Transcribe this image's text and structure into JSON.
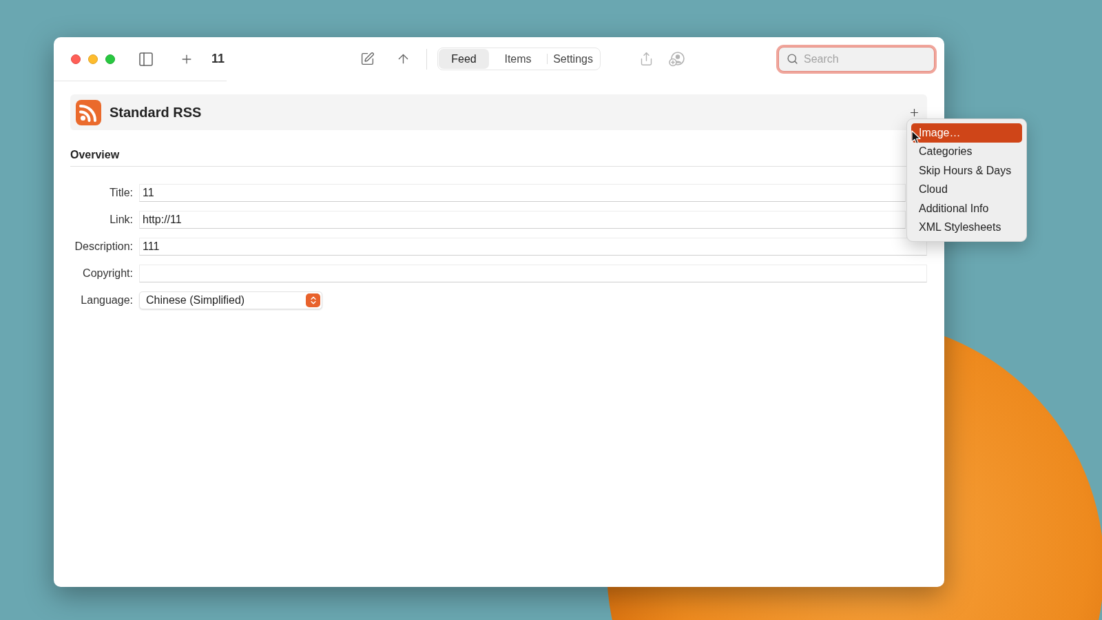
{
  "window": {
    "title": "11"
  },
  "toolbar": {
    "tabs": [
      {
        "label": "Feed",
        "selected": true
      },
      {
        "label": "Items",
        "selected": false
      },
      {
        "label": "Settings",
        "selected": false
      }
    ],
    "share_button": {
      "disabled": true
    },
    "collaborate_button": {
      "disabled": true
    },
    "search": {
      "placeholder": "Search",
      "focused": true
    }
  },
  "feed_header": {
    "title": "Standard RSS"
  },
  "overview": {
    "heading": "Overview",
    "fields": [
      {
        "label": "Title:",
        "kind": "text",
        "value": "11"
      },
      {
        "label": "Link:",
        "kind": "text",
        "value": "http://11"
      },
      {
        "label": "Description:",
        "kind": "text",
        "value": "111"
      },
      {
        "label": "Copyright:",
        "kind": "text"
      },
      {
        "label": "Language:",
        "kind": "select",
        "value": "Chinese (Simplified)"
      }
    ]
  },
  "add_menu": {
    "items": [
      {
        "label": "Image…",
        "selected": true
      },
      {
        "label": "Categories",
        "selected": false
      },
      {
        "label": "Skip Hours & Days",
        "selected": false
      },
      {
        "label": "Cloud",
        "selected": false
      },
      {
        "label": "Additional Info",
        "selected": false
      },
      {
        "label": "XML Stylesheets",
        "selected": false
      }
    ]
  }
}
